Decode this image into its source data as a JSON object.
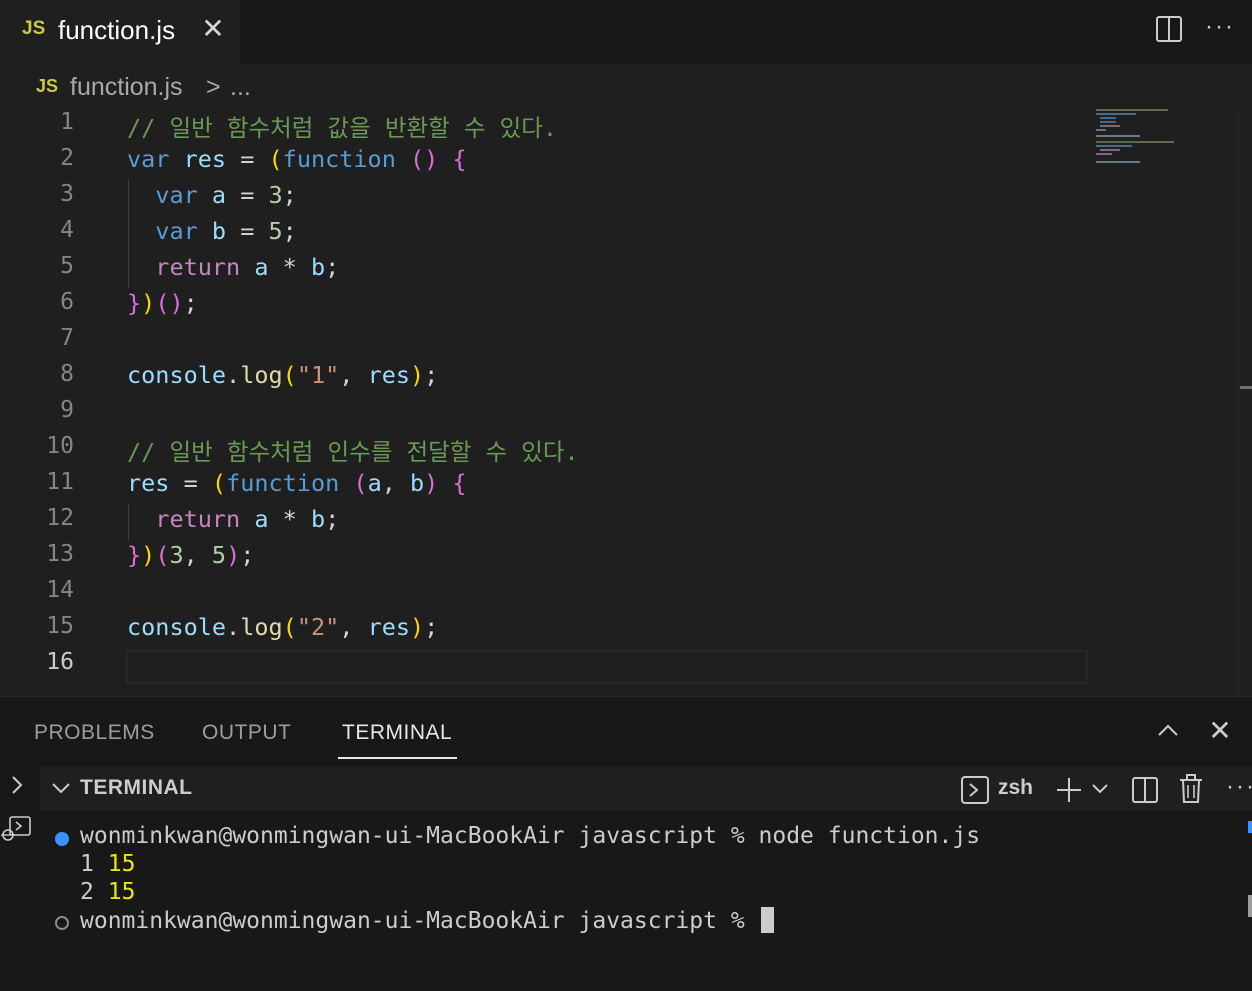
{
  "tab": {
    "badge": "JS",
    "title": "function.js"
  },
  "breadcrumb": {
    "badge": "JS",
    "file": "function.js",
    "separator": ">",
    "more": "..."
  },
  "editor": {
    "line_numbers": [
      "1",
      "2",
      "3",
      "4",
      "5",
      "6",
      "7",
      "8",
      "9",
      "10",
      "11",
      "12",
      "13",
      "14",
      "15",
      "16"
    ],
    "current_line": "16",
    "code": [
      [
        {
          "t": "// 일반 함수처럼 값을 반환할 수 있다.",
          "c": "c-comment"
        }
      ],
      [
        {
          "t": "var",
          "c": "c-kw"
        },
        {
          "t": " ",
          "c": "c-op"
        },
        {
          "t": "res",
          "c": "c-var"
        },
        {
          "t": " = ",
          "c": "c-op"
        },
        {
          "t": "(",
          "c": "c-brace"
        },
        {
          "t": "function",
          "c": "c-kw"
        },
        {
          "t": " ",
          "c": "c-op"
        },
        {
          "t": "()",
          "c": "c-paren"
        },
        {
          "t": " ",
          "c": "c-op"
        },
        {
          "t": "{",
          "c": "c-paren"
        }
      ],
      [
        {
          "t": "  ",
          "c": "c-op"
        },
        {
          "t": "var",
          "c": "c-kw"
        },
        {
          "t": " ",
          "c": "c-op"
        },
        {
          "t": "a",
          "c": "c-var"
        },
        {
          "t": " = ",
          "c": "c-op"
        },
        {
          "t": "3",
          "c": "c-num"
        },
        {
          "t": ";",
          "c": "c-op"
        }
      ],
      [
        {
          "t": "  ",
          "c": "c-op"
        },
        {
          "t": "var",
          "c": "c-kw"
        },
        {
          "t": " ",
          "c": "c-op"
        },
        {
          "t": "b",
          "c": "c-var"
        },
        {
          "t": " = ",
          "c": "c-op"
        },
        {
          "t": "5",
          "c": "c-num"
        },
        {
          "t": ";",
          "c": "c-op"
        }
      ],
      [
        {
          "t": "  ",
          "c": "c-op"
        },
        {
          "t": "return",
          "c": "c-ret"
        },
        {
          "t": " ",
          "c": "c-op"
        },
        {
          "t": "a",
          "c": "c-var"
        },
        {
          "t": " * ",
          "c": "c-op"
        },
        {
          "t": "b",
          "c": "c-var"
        },
        {
          "t": ";",
          "c": "c-op"
        }
      ],
      [
        {
          "t": "}",
          "c": "c-paren"
        },
        {
          "t": ")",
          "c": "c-brace"
        },
        {
          "t": "()",
          "c": "c-paren"
        },
        {
          "t": ";",
          "c": "c-op"
        }
      ],
      [],
      [
        {
          "t": "console",
          "c": "c-var"
        },
        {
          "t": ".",
          "c": "c-op"
        },
        {
          "t": "log",
          "c": "c-fn"
        },
        {
          "t": "(",
          "c": "c-brace"
        },
        {
          "t": "\"1\"",
          "c": "c-str"
        },
        {
          "t": ", ",
          "c": "c-op"
        },
        {
          "t": "res",
          "c": "c-var"
        },
        {
          "t": ")",
          "c": "c-brace"
        },
        {
          "t": ";",
          "c": "c-op"
        }
      ],
      [],
      [
        {
          "t": "// 일반 함수처럼 인수를 전달할 수 있다.",
          "c": "c-comment"
        }
      ],
      [
        {
          "t": "res",
          "c": "c-var"
        },
        {
          "t": " = ",
          "c": "c-op"
        },
        {
          "t": "(",
          "c": "c-brace"
        },
        {
          "t": "function",
          "c": "c-kw"
        },
        {
          "t": " ",
          "c": "c-op"
        },
        {
          "t": "(",
          "c": "c-paren"
        },
        {
          "t": "a",
          "c": "c-var"
        },
        {
          "t": ", ",
          "c": "c-op"
        },
        {
          "t": "b",
          "c": "c-var"
        },
        {
          "t": ")",
          "c": "c-paren"
        },
        {
          "t": " ",
          "c": "c-op"
        },
        {
          "t": "{",
          "c": "c-paren"
        }
      ],
      [
        {
          "t": "  ",
          "c": "c-op"
        },
        {
          "t": "return",
          "c": "c-ret"
        },
        {
          "t": " ",
          "c": "c-op"
        },
        {
          "t": "a",
          "c": "c-var"
        },
        {
          "t": " * ",
          "c": "c-op"
        },
        {
          "t": "b",
          "c": "c-var"
        },
        {
          "t": ";",
          "c": "c-op"
        }
      ],
      [
        {
          "t": "}",
          "c": "c-paren"
        },
        {
          "t": ")",
          "c": "c-brace"
        },
        {
          "t": "(",
          "c": "c-paren"
        },
        {
          "t": "3",
          "c": "c-num"
        },
        {
          "t": ", ",
          "c": "c-op"
        },
        {
          "t": "5",
          "c": "c-num"
        },
        {
          "t": ")",
          "c": "c-paren"
        },
        {
          "t": ";",
          "c": "c-op"
        }
      ],
      [],
      [
        {
          "t": "console",
          "c": "c-var"
        },
        {
          "t": ".",
          "c": "c-op"
        },
        {
          "t": "log",
          "c": "c-fn"
        },
        {
          "t": "(",
          "c": "c-brace"
        },
        {
          "t": "\"2\"",
          "c": "c-str"
        },
        {
          "t": ", ",
          "c": "c-op"
        },
        {
          "t": "res",
          "c": "c-var"
        },
        {
          "t": ")",
          "c": "c-brace"
        },
        {
          "t": ";",
          "c": "c-op"
        }
      ],
      []
    ]
  },
  "panel": {
    "tabs": [
      "PROBLEMS",
      "OUTPUT",
      "TERMINAL"
    ],
    "active_tab": "TERMINAL"
  },
  "terminal": {
    "section_title": "TERMINAL",
    "shell_name": "zsh",
    "command_prompt": "wonminkwan@wonmingwan-ui-MacBookAir javascript % ",
    "command": "node function.js",
    "output": [
      {
        "label": "1",
        "value": "15"
      },
      {
        "label": "2",
        "value": "15"
      }
    ],
    "idle_prompt": "wonminkwan@wonmingwan-ui-MacBookAir javascript % "
  },
  "colors": {
    "accent_blue": "#3794ff",
    "bg_editor": "#1f1f1f",
    "bg_panel": "#181818",
    "js_badge": "#cbcb41"
  }
}
